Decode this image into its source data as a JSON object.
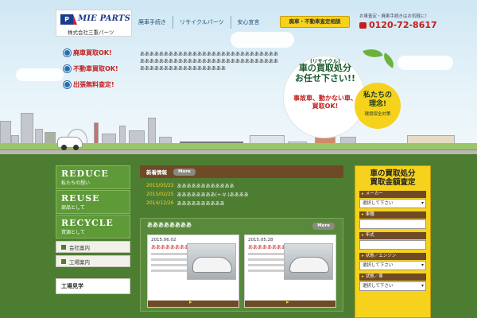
{
  "header": {
    "logo_mark": "P",
    "logo_text": "MIE PARTS",
    "company_name": "株式会社三重パーツ",
    "nav": [
      "廃車手続き",
      "リサイクルパーツ",
      "安心宣言"
    ],
    "consult_button": "廃車・不動車査定相談",
    "tel_note": "お車査定・廃車手続きはお気軽に！",
    "tel": "0120-72-8617"
  },
  "hero": {
    "pills": [
      "廃車買取OK!",
      "不動車買取OK!",
      "出張無料査定!"
    ],
    "intro": "ああああああああああああああああああああああああああああああああああああああああああああああああああああああああああああああああああああああああああああ",
    "bubble": {
      "small": "(リサイクル)",
      "title": "車の買取処分\nお任せ下さい!!",
      "sub": "事故車、動かない車、\n買取OK!"
    },
    "badge": {
      "title": "私たちの\n理念!",
      "sub": "環境保全対策"
    }
  },
  "sidebar": {
    "big": [
      {
        "title": "REDUCE",
        "sub": "私たちの想い"
      },
      {
        "title": "REUSE",
        "sub": "部品として"
      },
      {
        "title": "RECYCLE",
        "sub": "資源として"
      }
    ],
    "small": [
      "会社案内",
      "工場案内"
    ],
    "factory": "工場見学"
  },
  "news": {
    "title": "新着情報",
    "more": "More",
    "items": [
      {
        "date": "2015/05/23",
        "text": "ああああああああああああ"
      },
      {
        "date": "2015/02/25",
        "text": "ああああああああ(+-∀-)ああああ"
      },
      {
        "date": "2014/12/26",
        "text": "ああああああああああ"
      }
    ]
  },
  "recent": {
    "title": "ああああああああ",
    "more": "More",
    "cards": [
      {
        "date": "2015.06.02",
        "title": "ああああああああ"
      },
      {
        "date": "2015.05.28",
        "title": "ああああああああ"
      }
    ]
  },
  "estimate": {
    "title": "車の買取処分\n買取金額査定",
    "fields": [
      {
        "label": "メーカー",
        "value": "選択して下さい"
      },
      {
        "label": "車種",
        "value": ""
      },
      {
        "label": "年式",
        "value": ""
      },
      {
        "label": "状態／エンジン",
        "value": "選択して下さい"
      },
      {
        "label": "状態／車",
        "value": "選択して下さい"
      }
    ]
  }
}
